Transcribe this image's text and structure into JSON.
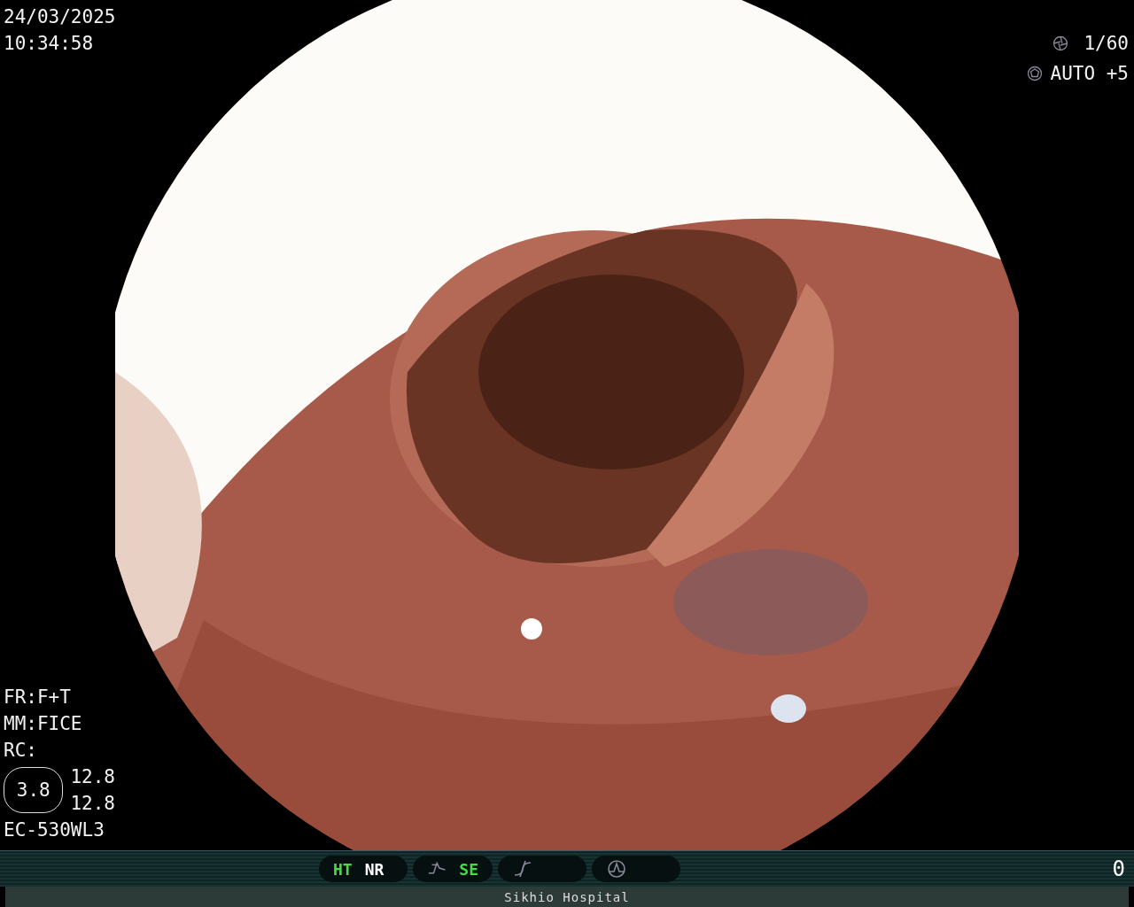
{
  "date": "24/03/2025",
  "time": "10:34:58",
  "exposure": {
    "shutter": "1/60",
    "iris": "AUTO +5"
  },
  "settings": [
    "FR:F+T",
    "MM:FICE",
    "RC:"
  ],
  "zoom_badge": "3.8",
  "readings": [
    "12.8",
    "12.8"
  ],
  "scope": "EC-530WL3",
  "indicator_groups": [
    {
      "kind": "plain",
      "labels": [
        {
          "text": "HT",
          "on": true
        },
        {
          "text": "NR",
          "on": false
        }
      ]
    },
    {
      "kind": "curve",
      "labels": [
        {
          "text": "SE",
          "on": true
        }
      ]
    },
    {
      "kind": "slash"
    },
    {
      "kind": "peak"
    }
  ],
  "counter": "0",
  "footer": "Sikhio Hospital"
}
